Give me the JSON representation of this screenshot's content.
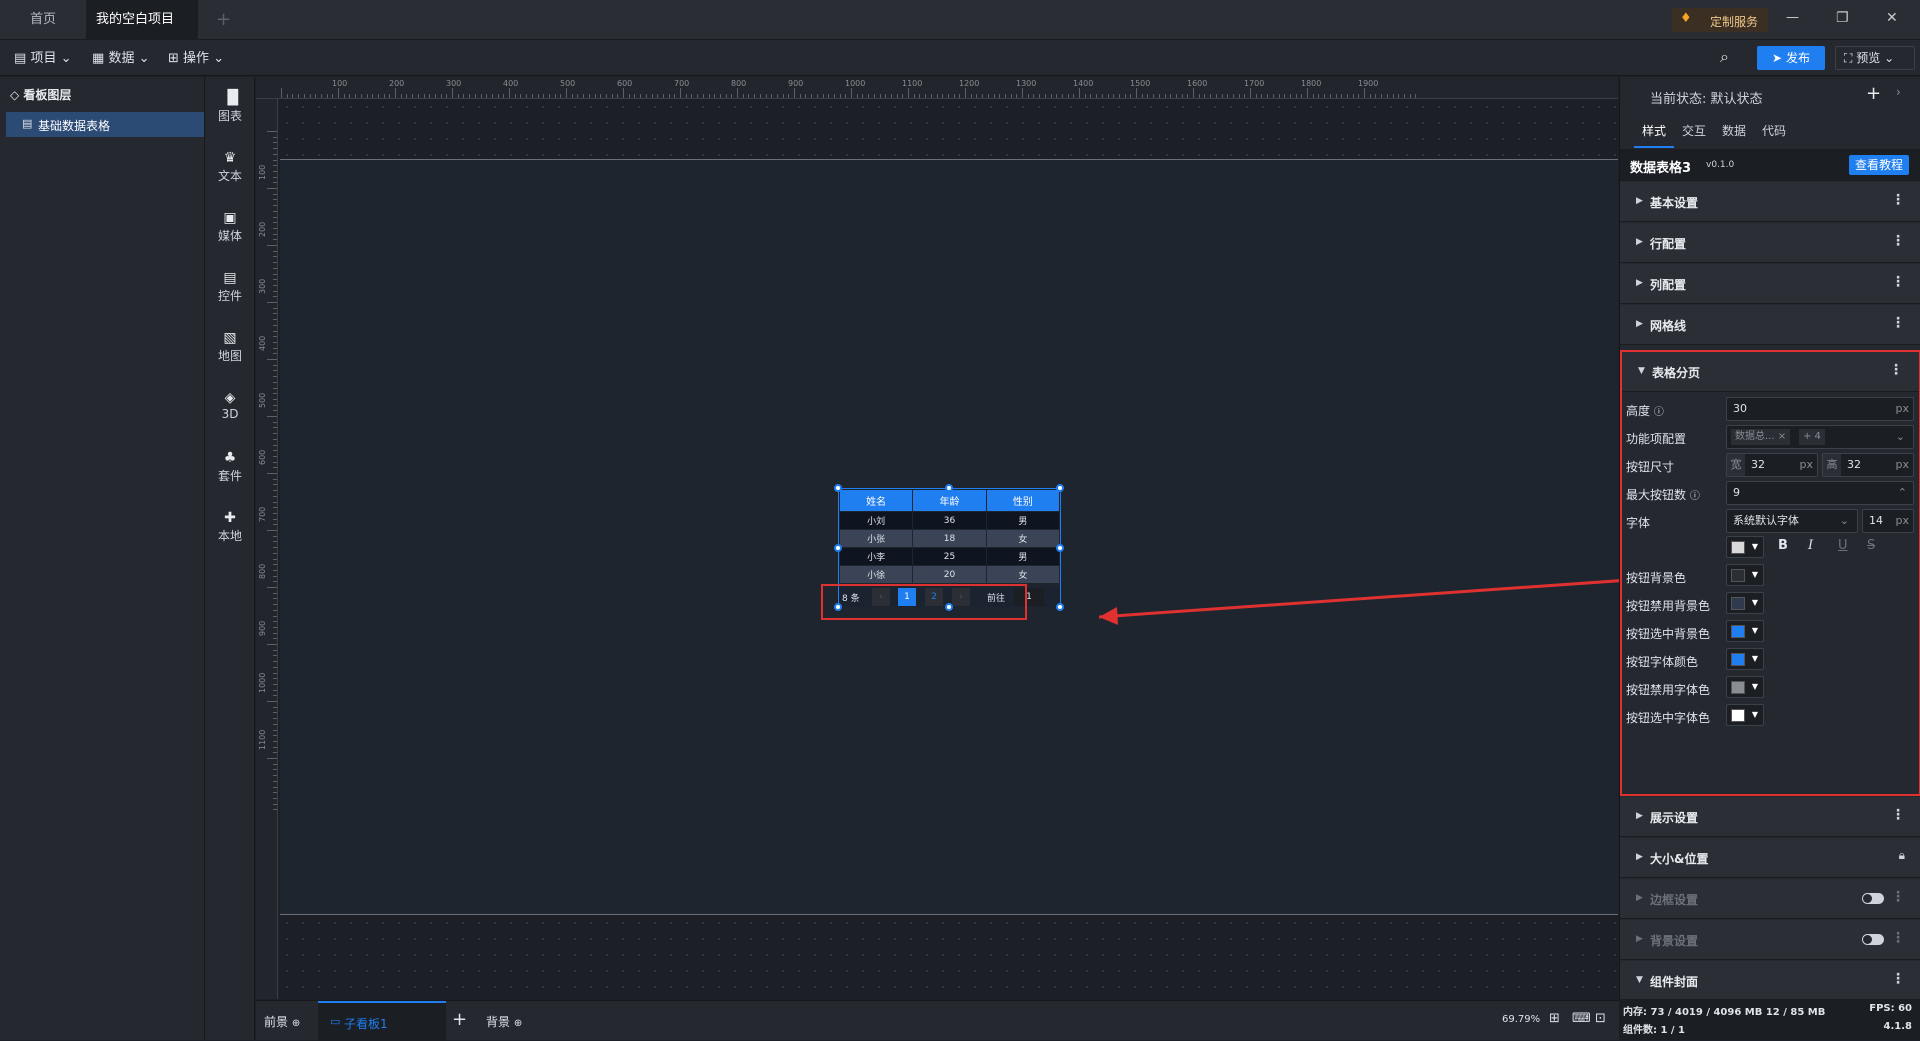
{
  "tabs": {
    "home": "首页",
    "project": "我的空白项目",
    "add": "+"
  },
  "window": {
    "custom_service": "定制服务",
    "minimize": "—",
    "restore": "❐",
    "close": "✕"
  },
  "toolbar": {
    "project": "项目",
    "data": "数据",
    "operate": "操作",
    "publish": "发布",
    "preview": "预览"
  },
  "layers": {
    "title": "看板图层",
    "items": [
      "基础数据表格"
    ]
  },
  "rail": [
    "图表",
    "文本",
    "媒体",
    "控件",
    "地图",
    "3D",
    "套件",
    "本地"
  ],
  "ruler_top": [
    "100",
    "200",
    "300",
    "400",
    "500",
    "600",
    "700",
    "800",
    "900",
    "1000",
    "1100",
    "1200",
    "1300",
    "1400",
    "1500",
    "1600",
    "1700",
    "1800",
    "1900"
  ],
  "ruler_left": [
    "100",
    "200",
    "300",
    "400",
    "500",
    "600",
    "700",
    "800",
    "900",
    "1000",
    "1100"
  ],
  "table": {
    "headers": [
      "姓名",
      "年龄",
      "性别"
    ],
    "rows": [
      [
        "小刘",
        "36",
        "男"
      ],
      [
        "小张",
        "18",
        "女"
      ],
      [
        "小李",
        "25",
        "男"
      ],
      [
        "小徐",
        "20",
        "女"
      ]
    ],
    "pager": {
      "total": "8 条",
      "prev": "‹",
      "page1": "1",
      "page2": "2",
      "next": "›",
      "goto": "前往",
      "goto_value": "1"
    }
  },
  "right": {
    "state_label": "当前状态:",
    "state_value": "默认状态",
    "tabs": [
      "样式",
      "交互",
      "数据",
      "代码"
    ],
    "component_name": "数据表格3",
    "version": "v0.1.0",
    "tutorial": "查看教程",
    "sections_top": [
      "基本设置",
      "行配置",
      "列配置",
      "网格线"
    ],
    "pager_section": "表格分页",
    "props": {
      "height_label": "高度",
      "height_value": "30",
      "unit": "px",
      "func_label": "功能项配置",
      "func_tag": "数据总...",
      "func_more": "+ 4",
      "btn_size_label": "按钮尺寸",
      "w_label": "宽",
      "w_value": "32",
      "h_label": "高",
      "h_value": "32",
      "max_btn_label": "最大按钮数",
      "max_btn_value": "9",
      "font_label": "字体",
      "font_value": "系统默认字体",
      "font_size": "14",
      "bold": "B",
      "italic": "I",
      "underline": "U",
      "strike": "S",
      "btn_bg": "按钮背景色",
      "btn_disabled_bg": "按钮禁用背景色",
      "btn_active_bg": "按钮选中背景色",
      "btn_font_color": "按钮字体颜色",
      "btn_disabled_font": "按钮禁用字体色",
      "btn_active_font": "按钮选中字体色"
    },
    "colors": {
      "font": "#d9d9d9",
      "btn_bg": "#2b2e35",
      "btn_disabled_bg": "#2f3a4e",
      "btn_active_bg": "#1f7ef0",
      "btn_font": "#1f7ef0",
      "btn_disabled_font": "#8a8d93",
      "btn_active_font": "#ffffff"
    },
    "sections_bottom": [
      "展示设置",
      "大小&位置",
      "边框设置",
      "背景设置",
      "组件封面"
    ]
  },
  "bottom": {
    "foreground": "前景",
    "sub_board": "子看板1",
    "add": "+",
    "background": "背景",
    "zoom": "69.79%"
  },
  "status": {
    "memory": "内存: 73 / 4019 / 4096 MB 12 / 85 MB",
    "fps": "FPS: 60",
    "components": "组件数: 1 / 1",
    "version": "4.1.8"
  }
}
